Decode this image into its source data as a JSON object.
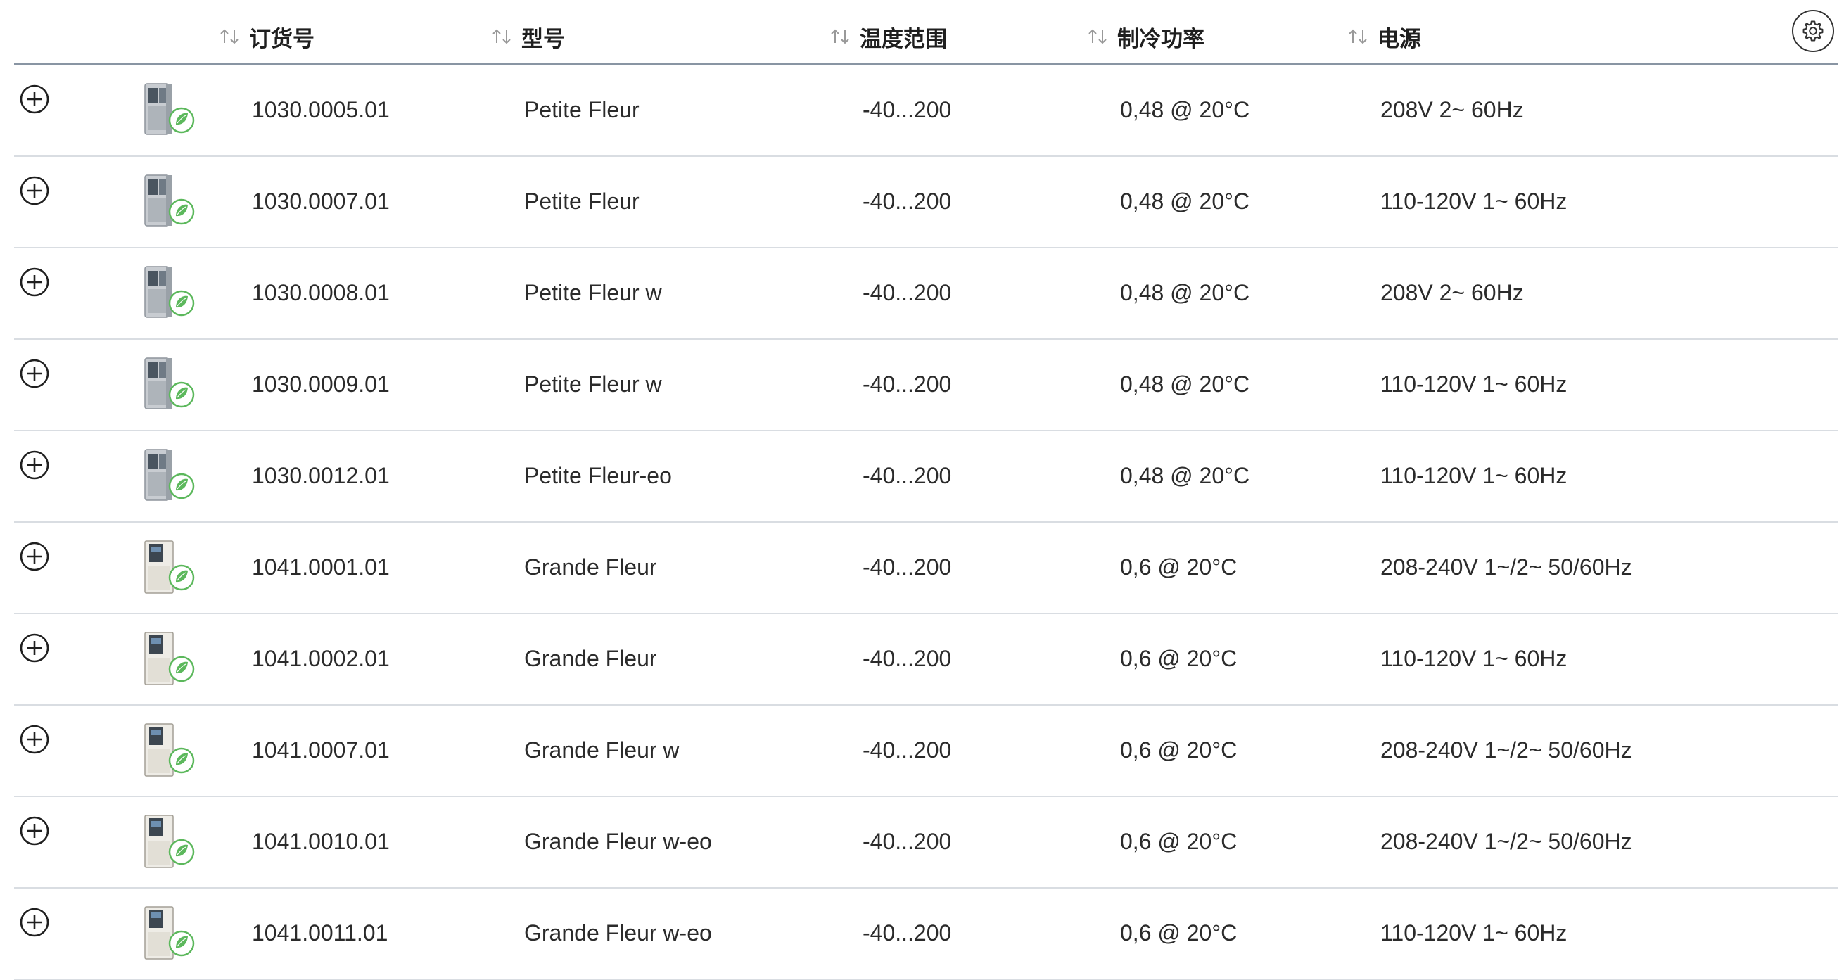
{
  "header": {
    "order_no": "订货号",
    "model": "型号",
    "temp_range": "温度范围",
    "cooling_power": "制冷功率",
    "power_supply": "电源"
  },
  "rows": [
    {
      "order_no": "1030.0005.01",
      "model": "Petite Fleur",
      "temp_range": "-40...200",
      "cooling_power": "0,48 @ 20°C",
      "power_supply": "208V 2~ 60Hz",
      "product_image": "petite-fleur-chiller"
    },
    {
      "order_no": "1030.0007.01",
      "model": "Petite Fleur",
      "temp_range": "-40...200",
      "cooling_power": "0,48 @ 20°C",
      "power_supply": "110-120V 1~ 60Hz",
      "product_image": "petite-fleur-chiller"
    },
    {
      "order_no": "1030.0008.01",
      "model": "Petite Fleur w",
      "temp_range": "-40...200",
      "cooling_power": "0,48 @ 20°C",
      "power_supply": "208V 2~ 60Hz",
      "product_image": "petite-fleur-chiller"
    },
    {
      "order_no": "1030.0009.01",
      "model": "Petite Fleur w",
      "temp_range": "-40...200",
      "cooling_power": "0,48 @ 20°C",
      "power_supply": "110-120V 1~ 60Hz",
      "product_image": "petite-fleur-chiller"
    },
    {
      "order_no": "1030.0012.01",
      "model": "Petite Fleur-eo",
      "temp_range": "-40...200",
      "cooling_power": "0,48 @ 20°C",
      "power_supply": "110-120V 1~ 60Hz",
      "product_image": "petite-fleur-chiller"
    },
    {
      "order_no": "1041.0001.01",
      "model": "Grande Fleur",
      "temp_range": "-40...200",
      "cooling_power": "0,6 @ 20°C",
      "power_supply": "208-240V 1~/2~ 50/60Hz",
      "product_image": "grande-fleur-chiller"
    },
    {
      "order_no": "1041.0002.01",
      "model": "Grande Fleur",
      "temp_range": "-40...200",
      "cooling_power": "0,6 @ 20°C",
      "power_supply": "110-120V 1~ 60Hz",
      "product_image": "grande-fleur-chiller"
    },
    {
      "order_no": "1041.0007.01",
      "model": "Grande Fleur w",
      "temp_range": "-40...200",
      "cooling_power": "0,6 @ 20°C",
      "power_supply": "208-240V 1~/2~ 50/60Hz",
      "product_image": "grande-fleur-chiller"
    },
    {
      "order_no": "1041.0010.01",
      "model": "Grande Fleur w-eo",
      "temp_range": "-40...200",
      "cooling_power": "0,6 @ 20°C",
      "power_supply": "208-240V 1~/2~ 50/60Hz",
      "product_image": "grande-fleur-chiller"
    },
    {
      "order_no": "1041.0011.01",
      "model": "Grande Fleur w-eo",
      "temp_range": "-40...200",
      "cooling_power": "0,6 @ 20°C",
      "power_supply": "110-120V 1~ 60Hz",
      "product_image": "grande-fleur-chiller"
    }
  ],
  "icons": {
    "sort": "sort-arrows-icon",
    "expand": "plus-circle-icon",
    "settings": "gear-icon",
    "eco_badge": "green-leaf-icon"
  },
  "colors": {
    "header_rule": "#8995a3",
    "row_rule": "#d9dde2",
    "text": "#2b2b2b",
    "eco_green": "#5cb85c"
  }
}
